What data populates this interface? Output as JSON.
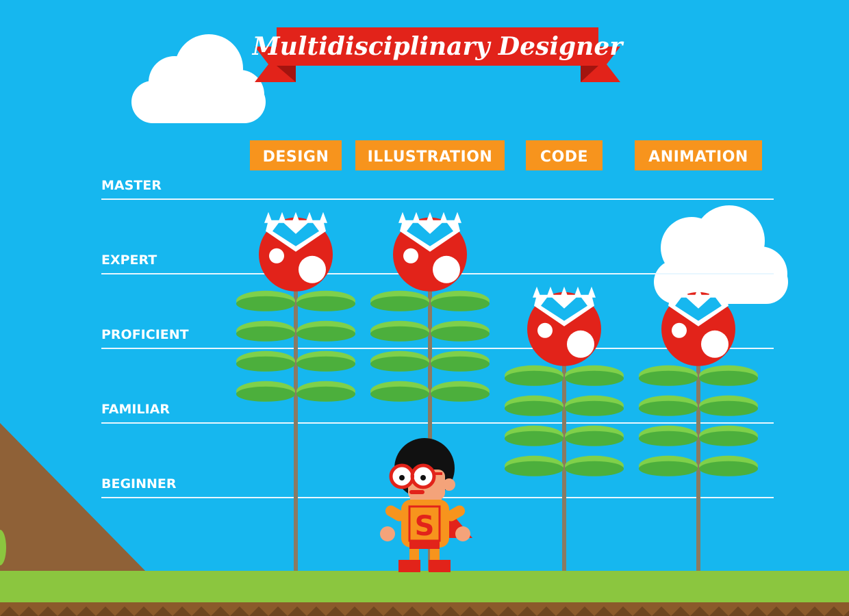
{
  "chart_data": {
    "type": "bar",
    "title": "Multidisciplinary Designer",
    "categories": [
      "DESIGN",
      "ILLUSTRATION",
      "CODE",
      "ANIMATION"
    ],
    "levels": [
      "BEGINNER",
      "FAMILIAR",
      "PROFICIENT",
      "EXPERT",
      "MASTER"
    ],
    "values": [
      3.8,
      3.8,
      2.8,
      2.8
    ],
    "ylim": [
      0,
      5
    ],
    "grid": true
  },
  "hero": {
    "emblem_letter": "S"
  },
  "colors": {
    "sky": "#16b7ef",
    "banner": "#e2231a",
    "banner_dark": "#a3140f",
    "tag": "#f7941d",
    "grass": "#8bc63f",
    "grass_dark": "#6fa62f",
    "dirt": "#8b5a2b",
    "hill": "#8f6137",
    "leaf": "#4caf3c",
    "leaf_light": "#7fd04a",
    "stem": "#8a7a62",
    "head": "#e2231a",
    "gridline": "#e8f7ff"
  }
}
